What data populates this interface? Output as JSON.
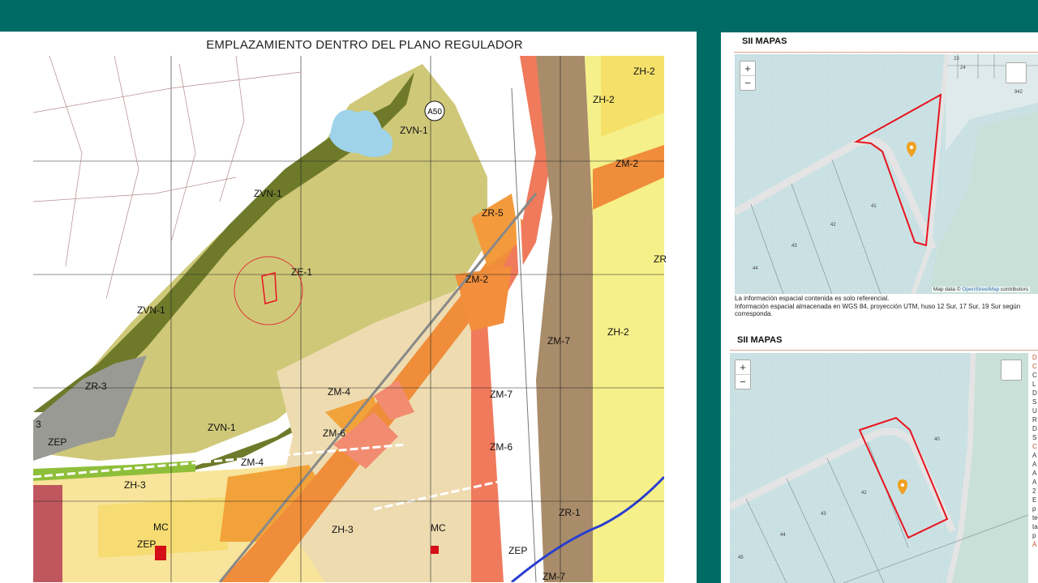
{
  "plan": {
    "title": "EMPLAZAMIENTO DENTRO DEL PLANO REGULADOR",
    "route_marker": "A50",
    "zones": [
      "ZH-2",
      "ZH-2",
      "ZM-2",
      "ZVN-1",
      "ZR-5",
      "ZVN-1",
      "ZE-1",
      "ZR",
      "ZM-2",
      "ZVN-1",
      "ZM-7",
      "ZH-2",
      "ZR-3",
      "ZM-4",
      "ZM-7",
      "3",
      "ZVN-1",
      "ZM-6",
      "ZM-6",
      "ZEP",
      "ZM-4",
      "ZH-3",
      "ZR-1",
      "MC",
      "MC",
      "ZH-3",
      "ZEP",
      "ZEP",
      "ZM-7"
    ]
  },
  "sii_top": {
    "title": "SII MAPAS",
    "zoom_in": "+",
    "zoom_out": "−",
    "attribution_prefix": "Map data ©",
    "attribution_link": "OpenStreetMap",
    "attribution_suffix": "contributors",
    "lots": [
      "23",
      "24",
      "942",
      "41",
      "42",
      "43",
      "44"
    ],
    "note_line1": "La información espacial contenida es solo referencial.",
    "note_line2": "Información espacial almacenada en WGS 84, proyección UTM, huso 12 Sur, 17 Sur, 19 Sur según corresponda."
  },
  "sii_bottom": {
    "title": "SII MAPAS",
    "zoom_in": "+",
    "zoom_out": "−",
    "lots": [
      "40",
      "42",
      "43",
      "44",
      "45"
    ],
    "side_letters": [
      "D",
      "C",
      "C",
      "L",
      "D",
      "S",
      "U",
      "R",
      "D",
      "S",
      "C",
      "A",
      "A",
      "A",
      "A",
      "2",
      "E",
      "p",
      "te",
      "ta",
      "p",
      "Á"
    ]
  },
  "colors": {
    "frame": "#006a64",
    "parcel": "#e8141e",
    "marker": "#f0a020"
  }
}
